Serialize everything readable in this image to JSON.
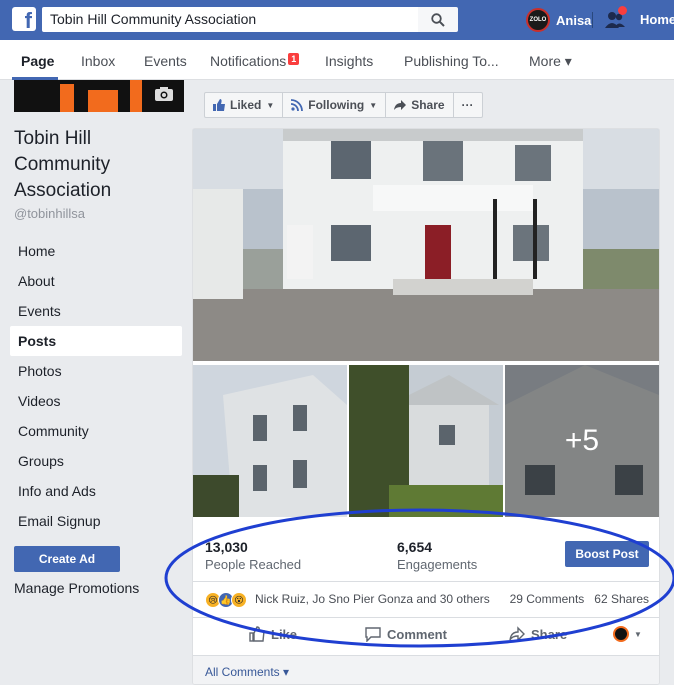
{
  "topbar": {
    "search_value": "Tobin Hill Community Association",
    "user_name": "Anisa",
    "home_label": "Home",
    "avatar_text": "ZOLO"
  },
  "tabs": [
    {
      "label": "Page",
      "active": true
    },
    {
      "label": "Inbox"
    },
    {
      "label": "Events"
    },
    {
      "label": "Notifications",
      "badge": "1"
    },
    {
      "label": "Insights"
    },
    {
      "label": "Publishing To..."
    },
    {
      "label": "More ▾"
    }
  ],
  "page": {
    "name_line1": "Tobin Hill",
    "name_line2": "Community",
    "name_line3": "Association",
    "handle": "@tobinhillsa"
  },
  "sidebar": {
    "items": [
      {
        "label": "Home"
      },
      {
        "label": "About"
      },
      {
        "label": "Events"
      },
      {
        "label": "Posts",
        "active": true
      },
      {
        "label": "Photos"
      },
      {
        "label": "Videos"
      },
      {
        "label": "Community"
      },
      {
        "label": "Groups"
      },
      {
        "label": "Info and Ads"
      },
      {
        "label": "Email Signup"
      }
    ],
    "create_ad_label": "Create Ad",
    "manage_promotions_label": "Manage Promotions"
  },
  "actions": {
    "liked": "Liked",
    "following": "Following",
    "share": "Share",
    "more": "···"
  },
  "post": {
    "more_photos": "+5",
    "people_reached_value": "13,030",
    "people_reached_label": "People Reached",
    "engagements_value": "6,654",
    "engagements_label": "Engagements",
    "boost_label": "Boost Post",
    "reaction_names": "Nick Ruiz, Jo Sno Pier Gonza and 30 others",
    "comments_count": "29 Comments",
    "shares_count": "62 Shares",
    "like_label": "Like",
    "comment_label": "Comment",
    "share_label": "Share",
    "all_comments_label": "All Comments ▾"
  },
  "colors": {
    "brand_blue": "#4267b2",
    "annotation_blue": "#1f3fd1",
    "notification_red": "#fa3e3e"
  }
}
